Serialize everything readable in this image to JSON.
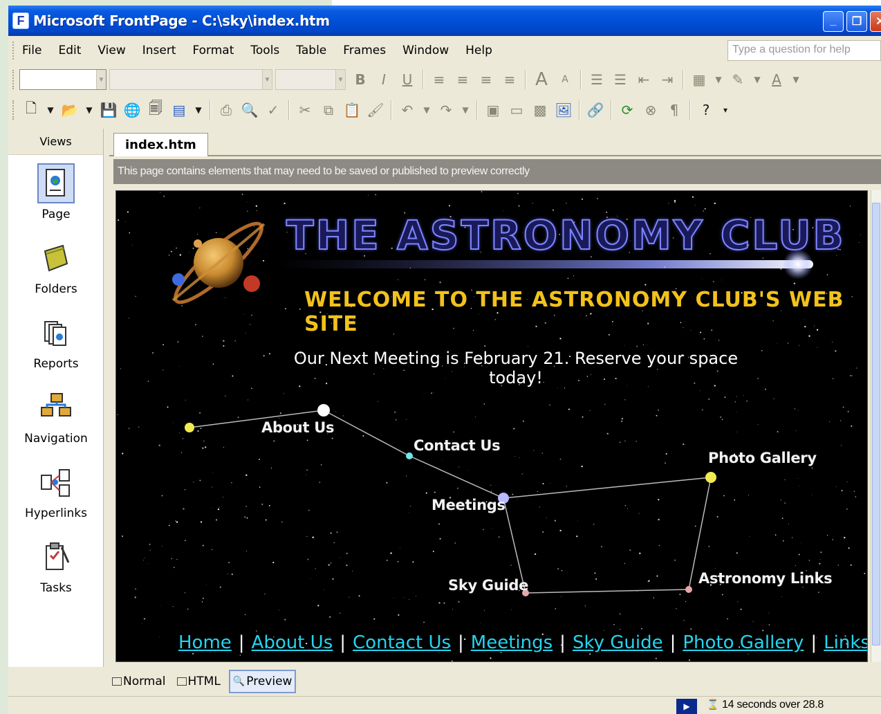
{
  "window": {
    "title": "Microsoft FrontPage - C:\\sky\\index.htm",
    "minimize": "_",
    "maximize": "❐",
    "close": "✕"
  },
  "menu": {
    "items": [
      {
        "label": "File"
      },
      {
        "label": "Edit"
      },
      {
        "label": "View"
      },
      {
        "label": "Insert"
      },
      {
        "label": "Format"
      },
      {
        "label": "Tools"
      },
      {
        "label": "Table"
      },
      {
        "label": "Frames"
      },
      {
        "label": "Window"
      },
      {
        "label": "Help"
      }
    ],
    "help_placeholder": "Type a question for help"
  },
  "format_toolbar": {
    "style_combo": "",
    "font_combo": "",
    "size_combo": "",
    "bold": "B",
    "italic": "I",
    "underline": "U"
  },
  "views": {
    "title": "Views",
    "items": [
      {
        "label": "Page",
        "icon": "page-view-icon"
      },
      {
        "label": "Folders",
        "icon": "folder-icon"
      },
      {
        "label": "Reports",
        "icon": "reports-icon"
      },
      {
        "label": "Navigation",
        "icon": "navigation-icon"
      },
      {
        "label": "Hyperlinks",
        "icon": "hyperlinks-icon"
      },
      {
        "label": "Tasks",
        "icon": "tasks-icon"
      }
    ]
  },
  "document": {
    "tab_label": "index.htm",
    "info_bar": "This page contains elements that may need to be saved or published to preview correctly"
  },
  "site": {
    "title": "THE ASTRONOMY CLUB",
    "welcome": "WELCOME TO THE ASTRONOMY CLUB'S WEB SITE",
    "meeting": "Our Next Meeting is February 21. Reserve your space today!",
    "constellation": {
      "about": "About Us",
      "contact": "Contact Us",
      "meetings": "Meetings",
      "photo": "Photo Gallery",
      "skyguide": "Sky Guide",
      "links": "Astronomy Links"
    },
    "nav": {
      "home": "Home",
      "about": "About Us",
      "contact": "Contact Us",
      "meetings": "Meetings",
      "skyguide": "Sky Guide",
      "photo": "Photo Gallery",
      "links": "Links",
      "separator": "|"
    }
  },
  "view_modes": {
    "normal": "Normal",
    "html": "HTML",
    "preview": "Preview"
  },
  "status": {
    "download_time": "14 seconds over 28.8"
  }
}
